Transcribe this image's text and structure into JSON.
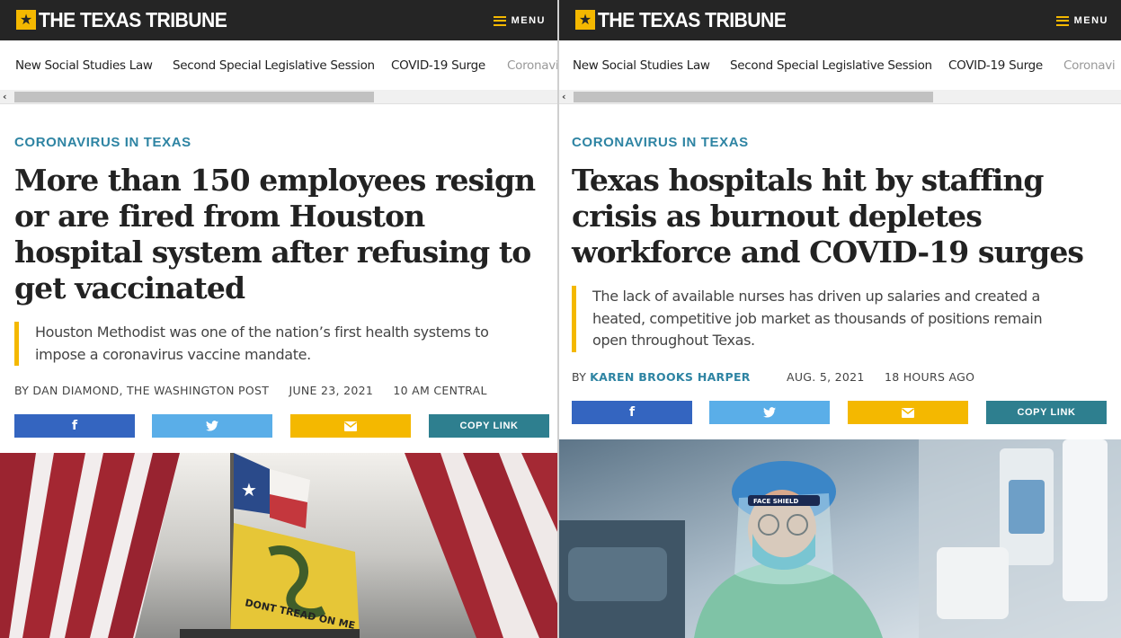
{
  "brand": {
    "logo_text": "THE TEXAS TRIBUNE",
    "menu_label": "MENU",
    "accent": "#f4b800",
    "topbar_color": "#252525"
  },
  "nav": {
    "items": [
      "New Social Studies Law",
      "Second Special Legislative Session",
      "COVID-19 Surge",
      "Coronavi"
    ]
  },
  "colors": {
    "section": "#2e84a3",
    "facebook": "#3465c0",
    "twitter": "#5aaee8",
    "email": "#f4b800",
    "copy_link": "#2e7f8f"
  },
  "articles": [
    {
      "section": "CORONAVIRUS IN TEXAS",
      "headline": "More than 150 employees resign or are fired from Houston hospital system after refusing to get vaccinated",
      "dek": "Houston Methodist was one of the nation’s first health systems to impose a coronavirus vaccine mandate.",
      "byline": "BY DAN DIAMOND, THE WASHINGTON POST",
      "date": "JUNE 23, 2021",
      "time": "10 AM CENTRAL",
      "share": {
        "facebook_icon": "facebook-icon",
        "twitter_icon": "twitter-icon",
        "email_icon": "envelope-icon",
        "copy_link_label": "COPY LINK"
      },
      "photo": {
        "flag_text": "DONT TREAD ON ME"
      }
    },
    {
      "section": "CORONAVIRUS IN TEXAS",
      "headline": "Texas hospitals hit by staffing crisis as burnout depletes workforce and COVID-19 surges",
      "dek": "The lack of available nurses has driven up salaries and created a heated, competitive job market as thousands of positions remain open throughout Texas.",
      "byline_prefix": "BY",
      "author": "KAREN BROOKS HARPER",
      "date": "AUG. 5, 2021",
      "time": "18 HOURS AGO",
      "share": {
        "facebook_icon": "facebook-icon",
        "twitter_icon": "twitter-icon",
        "email_icon": "envelope-icon",
        "copy_link_label": "COPY LINK"
      },
      "photo": {
        "shield_text": "FACE SHIELD"
      }
    }
  ]
}
